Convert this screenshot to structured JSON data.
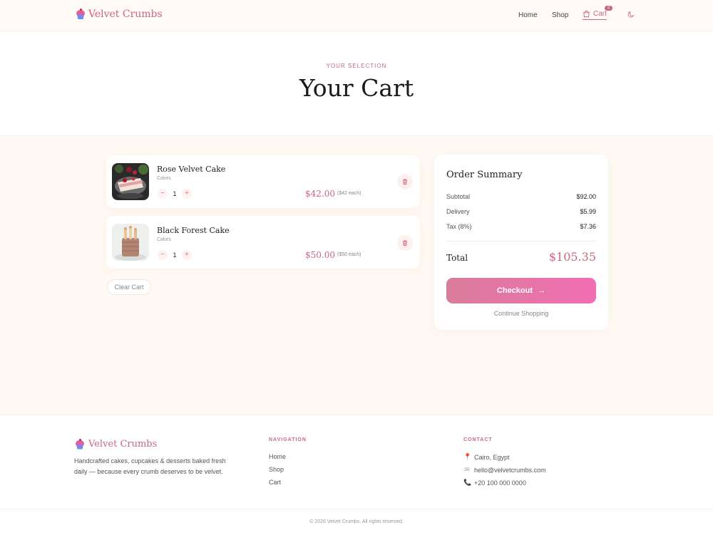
{
  "brand": {
    "name": "Velvet Crumbs"
  },
  "nav": {
    "home": "Home",
    "shop": "Shop",
    "cart": "Cart",
    "cart_count": "2"
  },
  "hero": {
    "eyebrow": "YOUR SELECTION",
    "title": "Your Cart"
  },
  "cart": {
    "items": [
      {
        "name": "Rose Velvet Cake",
        "category": "Cakes",
        "quantity": "1",
        "price": "$42.00",
        "each": "($42 each)"
      },
      {
        "name": "Black Forest Cake",
        "category": "Cakes",
        "quantity": "1",
        "price": "$50.00",
        "each": "($50 each)"
      }
    ],
    "clear_label": "Clear Cart"
  },
  "summary": {
    "title": "Order Summary",
    "subtotal_label": "Subtotal",
    "subtotal_value": "$92.00",
    "delivery_label": "Delivery",
    "delivery_value": "$5.99",
    "tax_label": "Tax (8%)",
    "tax_value": "$7.36",
    "total_label": "Total",
    "total_value": "$105.35",
    "checkout_label": "Checkout",
    "continue_label": "Continue Shopping"
  },
  "footer": {
    "description": "Handcrafted cakes, cupcakes & desserts baked fresh daily — because every crumb deserves to be velvet.",
    "nav_heading": "NAVIGATION",
    "nav_links": [
      "Home",
      "Shop",
      "Cart"
    ],
    "contact_heading": "CONTACT",
    "contact": [
      "Cairo, Egypt",
      "hello@velvetcrumbs.com",
      "+20 100 000 0000"
    ],
    "copyright": "© 2026 Velvet Crumbs. All rights reserved."
  },
  "colors": {
    "accent": "#c9677e",
    "checkout_gradient_start": "#d97c9a",
    "checkout_gradient_end": "#f16fb4",
    "page_tint": "#fff9f3"
  }
}
